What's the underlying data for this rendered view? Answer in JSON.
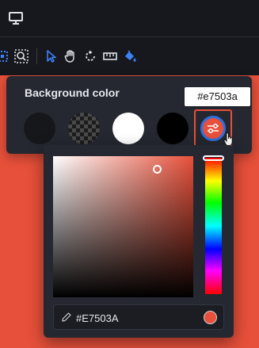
{
  "toolbar": {
    "icons": [
      "monitor-icon",
      "select-area-icon",
      "zoom-area-icon",
      "pointer-icon",
      "hand-icon",
      "rotate-icon",
      "ruler-icon",
      "paint-bucket-icon"
    ]
  },
  "background_panel": {
    "title": "Background color",
    "swatches": [
      {
        "name": "dark",
        "color": "#15171b"
      },
      {
        "name": "transparent",
        "color": "checkerboard"
      },
      {
        "name": "white",
        "color": "#ffffff"
      },
      {
        "name": "black",
        "color": "#000000"
      },
      {
        "name": "custom",
        "color": "#e7503a"
      }
    ]
  },
  "tooltip": {
    "text": "#e7503a"
  },
  "color_picker": {
    "hex_value": "#E7503A",
    "preview_color": "#e7503a"
  },
  "colors": {
    "accent": "#2f6fde",
    "selected": "#e7503a",
    "panel_bg": "#252831",
    "toolbar_bg": "#16181d"
  }
}
